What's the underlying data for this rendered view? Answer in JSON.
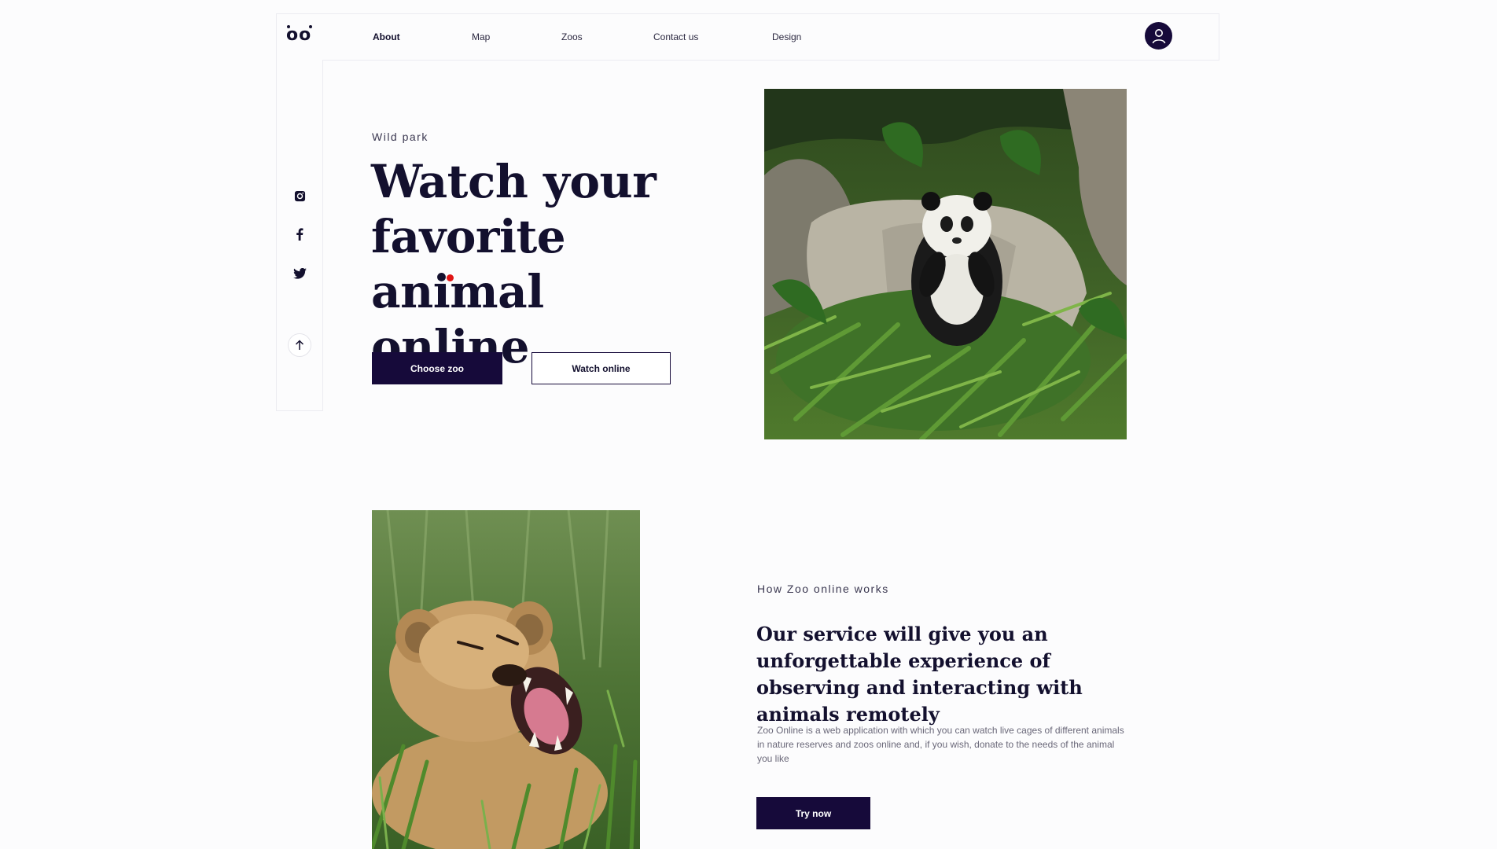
{
  "logo": {
    "text": "oo"
  },
  "nav": {
    "items": [
      {
        "label": "About",
        "active": true
      },
      {
        "label": "Map",
        "active": false
      },
      {
        "label": "Zoos",
        "active": false
      },
      {
        "label": "Contact us",
        "active": false
      },
      {
        "label": "Design",
        "active": false
      }
    ],
    "avatar_icon": "user-icon"
  },
  "sidebar": {
    "icons": [
      "instagram-icon",
      "facebook-icon",
      "twitter-icon"
    ],
    "scroll_up_icon": "arrow-up-icon"
  },
  "hero": {
    "eyebrow": "Wild park",
    "title_lines": [
      "Watch your",
      "favorite animal",
      "online"
    ],
    "primary_button": "Choose zoo",
    "secondary_button": "Watch online",
    "image_subject": "giant panda eating bamboo"
  },
  "section": {
    "eyebrow": "How Zoo online works",
    "title": "Our service will give you an unforgettable experience of observing and interacting with animals remotely",
    "body": "Zoo Online is a web application with which you can watch live cages of different animals in nature reserves and zoos online and, if you wish, donate to the needs of the animal you like",
    "cta_button": "Try now",
    "image_subject": "roaring lion cub in grass"
  },
  "colors": {
    "primary": "#160a3a",
    "accent_dot": "#e01515",
    "background": "#fcfcfd"
  }
}
